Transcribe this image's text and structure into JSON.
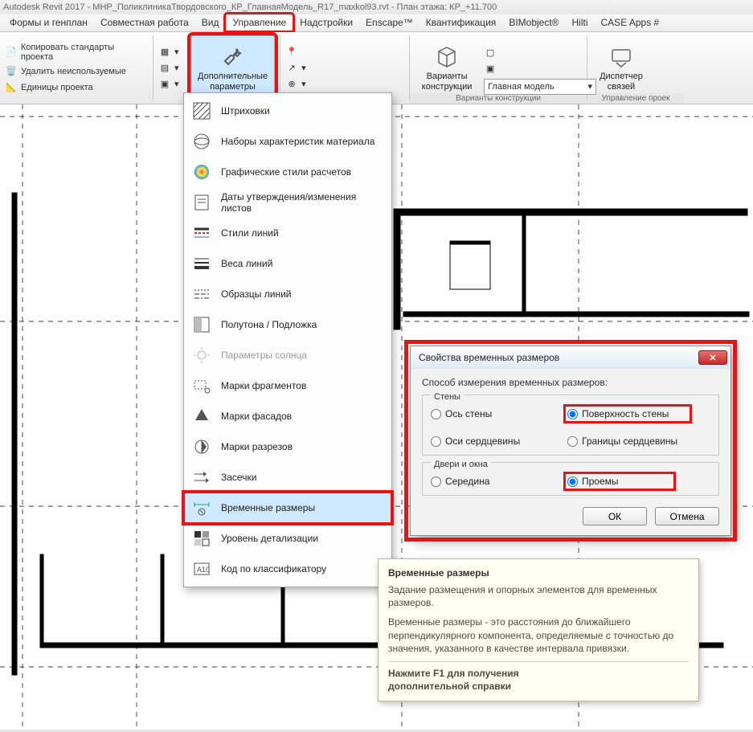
{
  "titlebar": "Autodesk Revit 2017 -   МНР_ПоликлиникаТвордовского_КР_ГлавнаяМодель_R17_maxkol93.rvt - План этажа: КР_+11.700",
  "tabs": {
    "t0": "Формы и генплан",
    "t1": "Совместная работа",
    "t2": "Вид",
    "t3": "Управление",
    "t4": "Надстройки",
    "t5": "Enscape™",
    "t6": "Квантификация",
    "t7": "BIMobject®",
    "t8": "Hilti",
    "t9": "CASE Apps #"
  },
  "leftcol": {
    "r0": "Копировать стандарты проекта",
    "r1": "Удалить неиспользуемые",
    "r2": "Единицы проекта"
  },
  "bigbtn": {
    "l1": "Дополнительные",
    "l2": "параметры"
  },
  "variants": {
    "l1": "Варианты",
    "l2": "конструкции",
    "panel": "Варианты конструкции",
    "combo": "Главная модель"
  },
  "dispatcher": {
    "l1": "Диспетчер",
    "l2": "связей",
    "panel": "Управление проек"
  },
  "dropdown": {
    "i0": "Штриховки",
    "i1": "Наборы характеристик материала",
    "i2": "Графические стили расчетов",
    "i3": "Даты утверждения/изменения листов",
    "i4": "Стили линий",
    "i5": "Веса линий",
    "i6": "Образцы линий",
    "i7": "Полутона / Подложка",
    "i8": "Параметры солнца",
    "i9": "Марки фрагментов",
    "i10": "Марки фасадов",
    "i11": "Марки разрезов",
    "i12": "Засечки",
    "i13": "Временные размеры",
    "i14": "Уровень детализации",
    "i15": "Код по классификатору"
  },
  "dialog": {
    "title": "Свойства временных размеров",
    "subtitle": "Способ измерения временных размеров:",
    "group1": "Стены",
    "g1r0": "Ось стены",
    "g1r1": "Поверхность стены",
    "g1r2": "Оси сердцевины",
    "g1r3": "Границы сердцевины",
    "group2": "Двери и окна",
    "g2r0": "Середина",
    "g2r1": "Проемы",
    "ok": "ОК",
    "cancel": "Отмена"
  },
  "tooltip": {
    "title": "Временные размеры",
    "p1": "Задание размещения и опорных элементов для временных размеров.",
    "p2": "Временные размеры - это расстояния до ближайшего перпендикулярного компонента, определяемые с точностью до значения, указанного в качестве интервала привязки.",
    "p3a": "Нажмите F1 для получения",
    "p3b": "дополнительной справки"
  }
}
